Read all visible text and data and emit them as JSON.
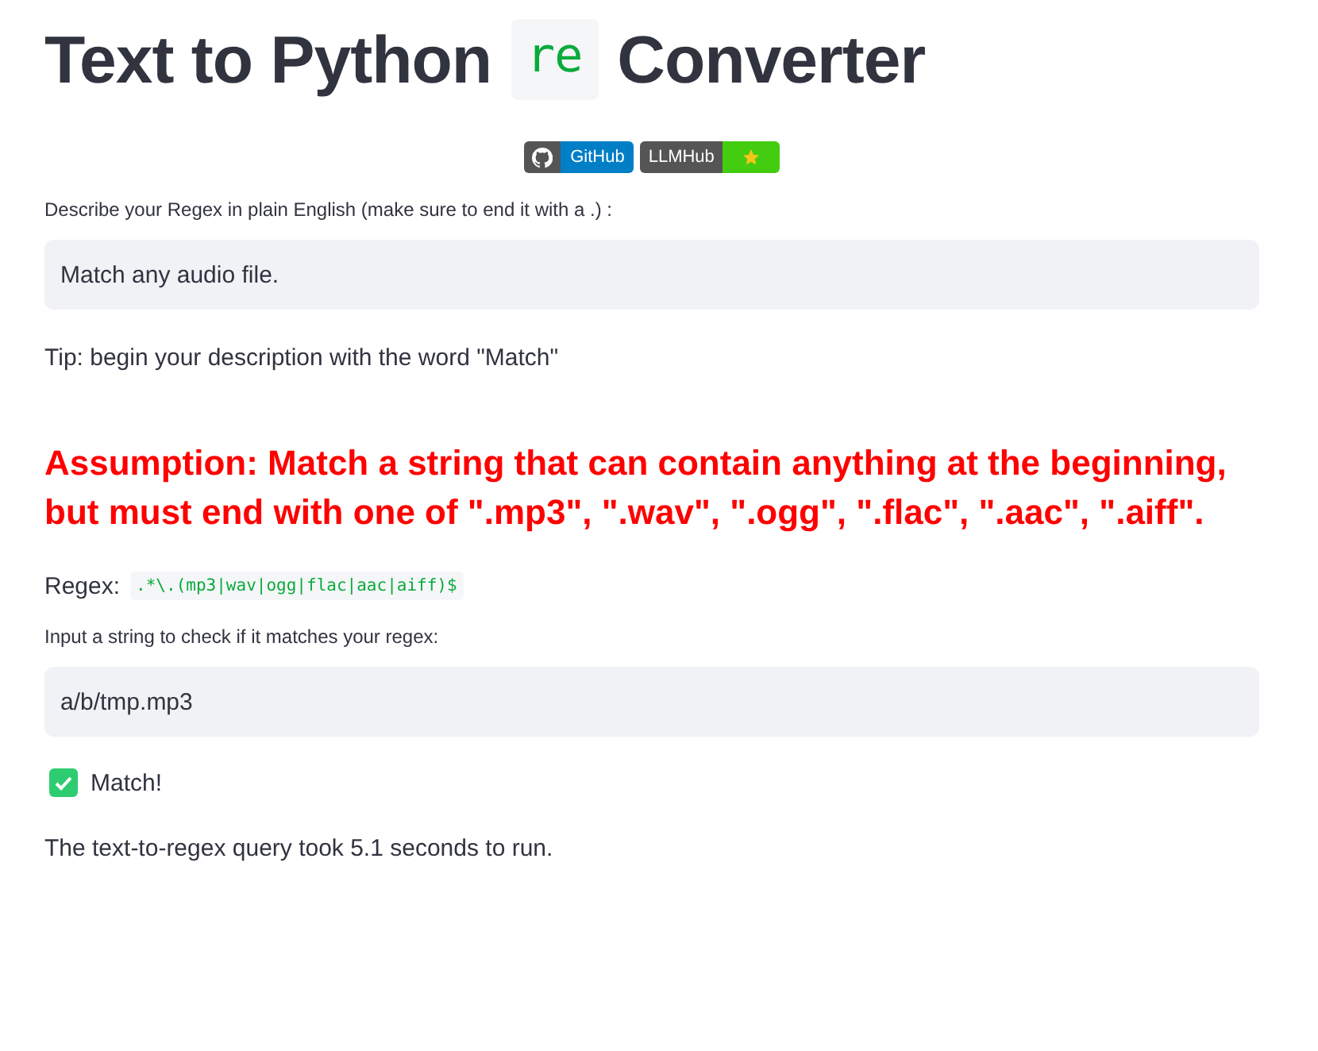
{
  "title": {
    "before": "Text to Python",
    "code": "re",
    "after": "Converter"
  },
  "badges": [
    {
      "kind": "github",
      "label": "GitHub"
    },
    {
      "kind": "llmhub",
      "label": "LLMHub"
    }
  ],
  "description_input": {
    "label": "Describe your Regex in plain English (make sure to end it with a .) :",
    "value": "Match any audio file."
  },
  "tip": "Tip: begin your description with the word \"Match\"",
  "assumption": "Assumption: Match a string that can contain anything at the beginning, but must end with one of \".mp3\", \".wav\", \".ogg\", \".flac\", \".aac\", \".aiff\".",
  "regex": {
    "label": "Regex:",
    "code": ".*\\.(mp3|wav|ogg|flac|aac|aiff)$"
  },
  "test_input": {
    "label": "Input a string to check if it matches your regex:",
    "value": "a/b/tmp.mp3"
  },
  "result": {
    "matched": true,
    "text": "Match!"
  },
  "timing": "The text-to-regex query took 5.1 seconds to run."
}
